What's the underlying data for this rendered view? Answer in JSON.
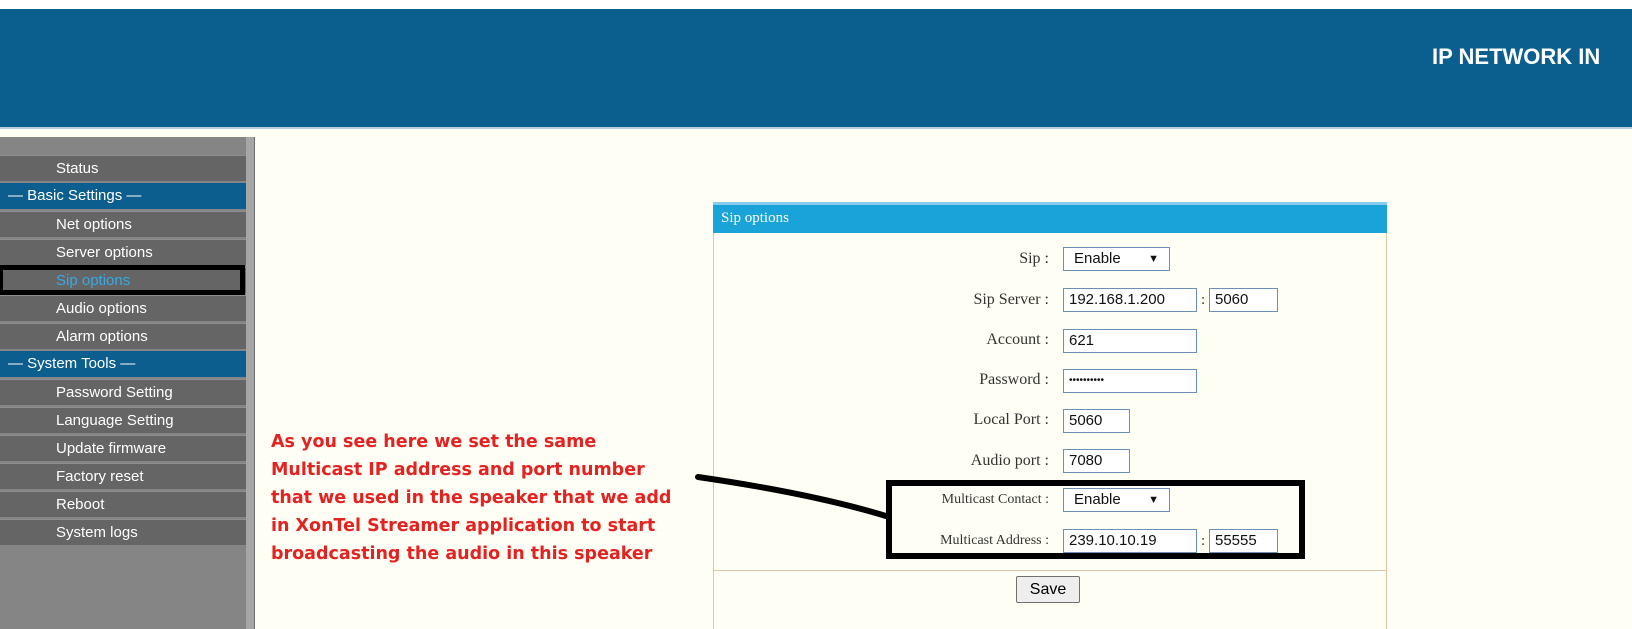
{
  "header": {
    "title": "IP NETWORK IN"
  },
  "sidebar": {
    "items": [
      {
        "label": "Status",
        "type": "link"
      },
      {
        "label": "— Basic Settings —",
        "type": "section"
      },
      {
        "label": "Net options",
        "type": "link"
      },
      {
        "label": "Server options",
        "type": "link"
      },
      {
        "label": "Sip options",
        "type": "link",
        "active": true
      },
      {
        "label": "Audio options",
        "type": "link"
      },
      {
        "label": "Alarm options",
        "type": "link"
      },
      {
        "label": "— System Tools —",
        "type": "section"
      },
      {
        "label": "Password Setting",
        "type": "link"
      },
      {
        "label": "Language Setting",
        "type": "link"
      },
      {
        "label": "Update firmware",
        "type": "link"
      },
      {
        "label": "Factory reset",
        "type": "link"
      },
      {
        "label": "Reboot",
        "type": "link"
      },
      {
        "label": "System logs",
        "type": "link"
      }
    ]
  },
  "panel": {
    "title": "Sip options",
    "sip_label": "Sip :",
    "sip_value": "Enable",
    "sip_server_label": "Sip Server :",
    "sip_server_value": "192.168.1.200",
    "sip_server_port": "5060",
    "account_label": "Account :",
    "account_value": "621",
    "password_label": "Password :",
    "password_value": "••••••••••",
    "local_port_label": "Local Port :",
    "local_port_value": "5060",
    "audio_port_label": "Audio port :",
    "audio_port_value": "7080",
    "multicast_contact_label": "Multicast Contact :",
    "multicast_contact_value": "Enable",
    "multicast_address_label": "Multicast Address :",
    "multicast_address_value": "239.10.10.19",
    "multicast_port_value": "55555",
    "separator": ":",
    "save_label": "Save"
  },
  "annotation": {
    "lines": [
      "As you see here we set the same",
      "Multicast IP address and port number",
      "that we used in the speaker that we add",
      "in XonTel Streamer application to start",
      "broadcasting the audio in this speaker"
    ]
  },
  "icons": {
    "dropdown": "triangle-down-icon"
  },
  "colors": {
    "header": "#0a5f8f",
    "panel_header": "#1aa3d9",
    "annotation": "#e32222",
    "active_link": "#38a9e3"
  }
}
